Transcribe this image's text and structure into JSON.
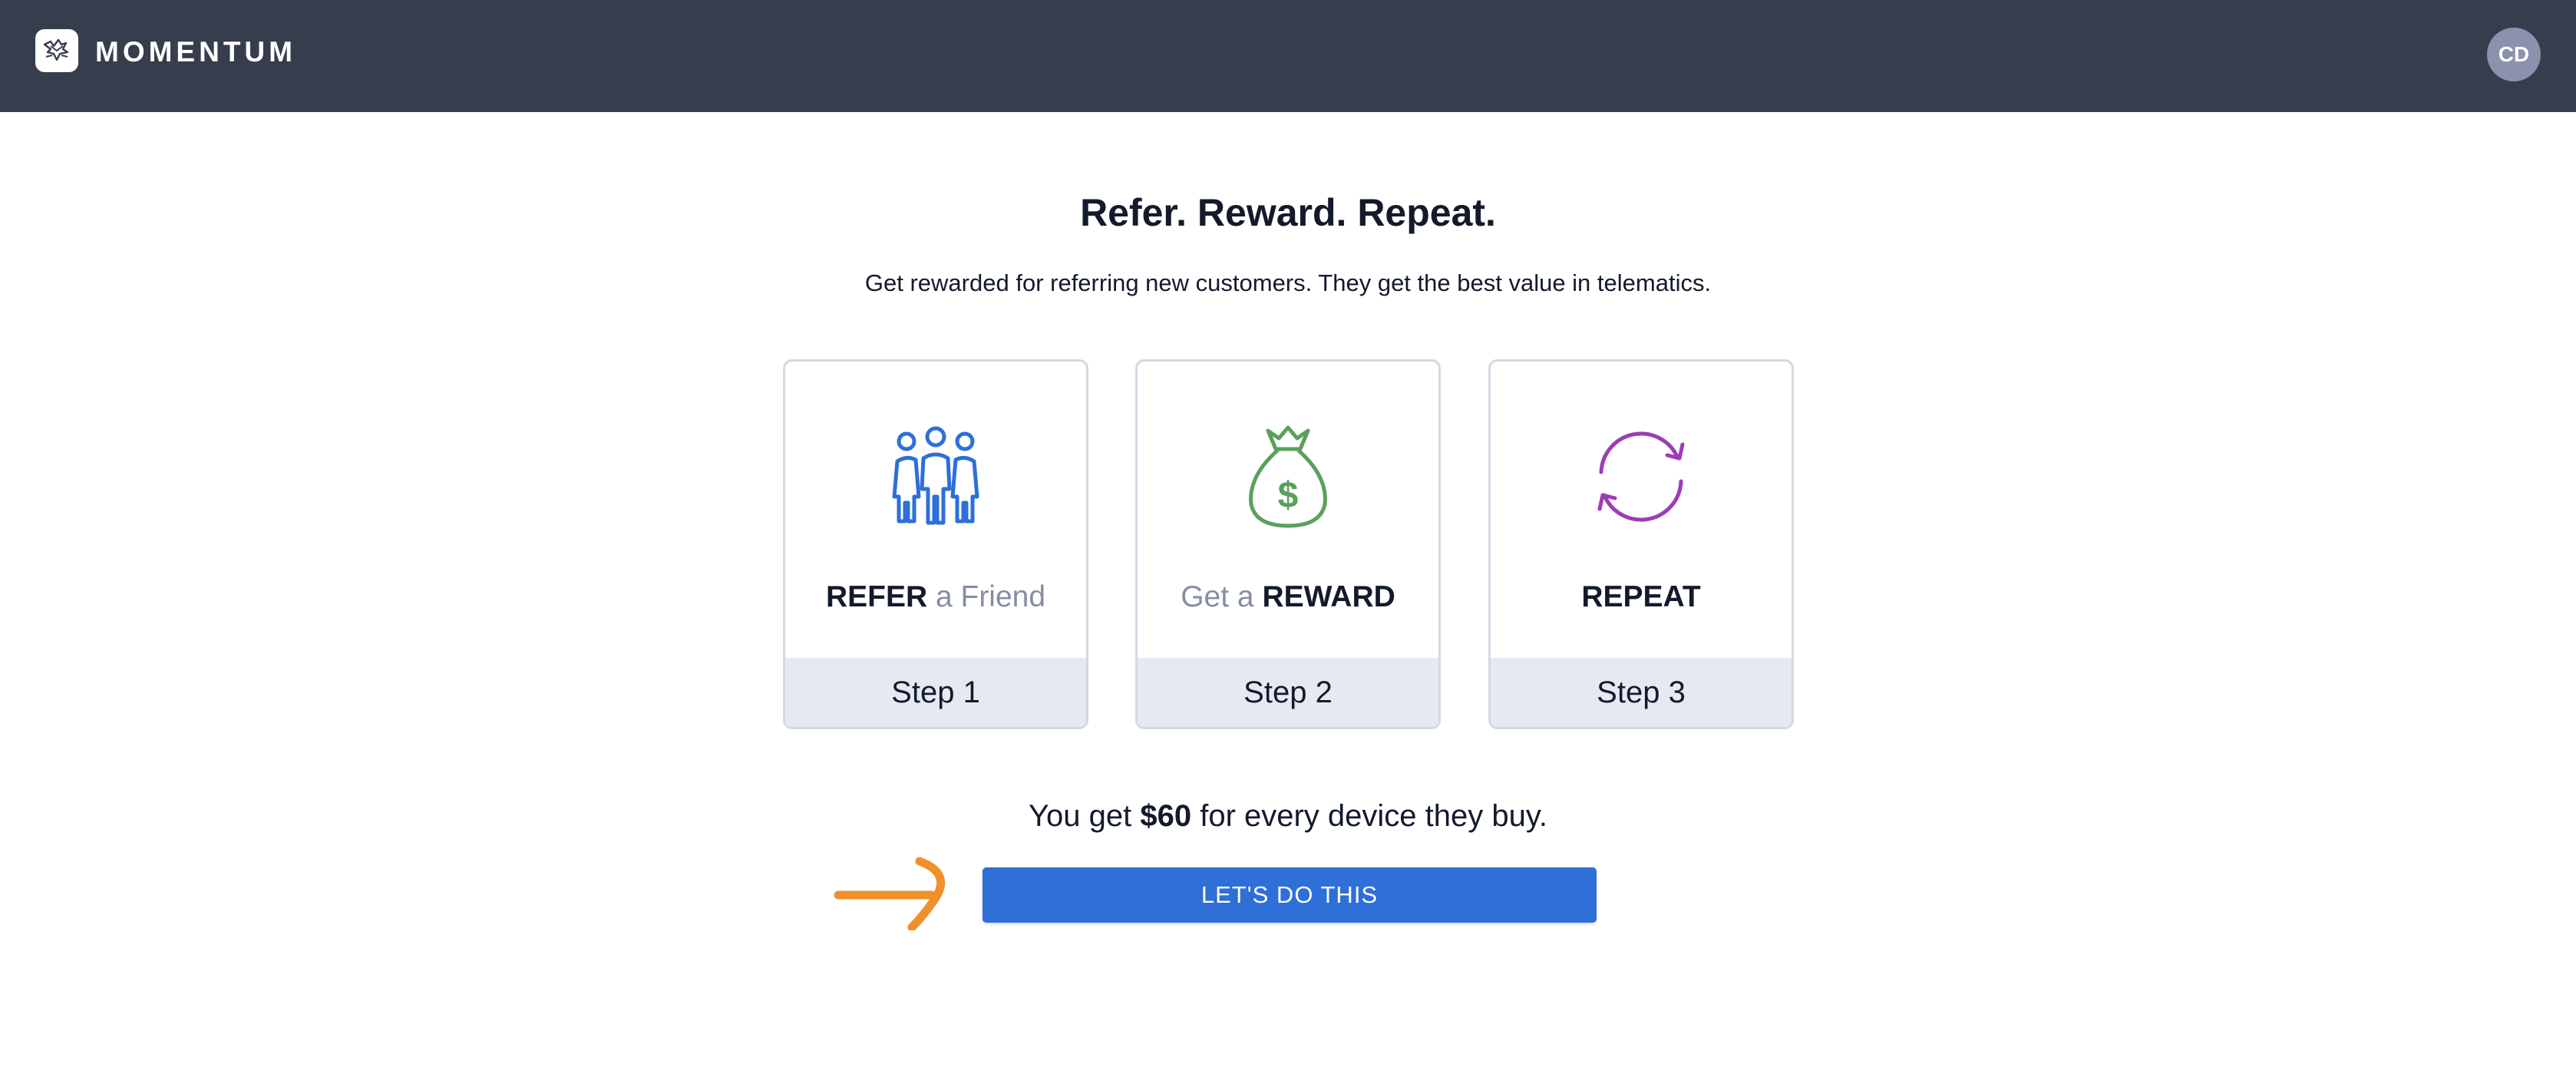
{
  "header": {
    "brand": "MOMENTUM",
    "avatar_initials": "CD",
    "logo_icon": "eagle-logo-icon"
  },
  "hero": {
    "title": "Refer. Reward. Repeat.",
    "subtitle": "Get rewarded for referring new customers. They get the best value in telematics."
  },
  "steps": [
    {
      "icon": "people-icon",
      "icon_color": "#2e6fd8",
      "title_strong": "REFER",
      "title_light": "a Friend",
      "step_label": "Step 1"
    },
    {
      "icon": "money-bag-icon",
      "icon_color": "#5aa05a",
      "title_light": "Get a",
      "title_strong": "REWARD",
      "step_label": "Step 2"
    },
    {
      "icon": "refresh-icon",
      "icon_color": "#9b3db5",
      "title_strong": "REPEAT",
      "step_label": "Step 3"
    }
  ],
  "offer": {
    "prefix": "You get",
    "amount": "$60",
    "suffix": "for every device they buy."
  },
  "cta": {
    "label": "LET'S DO THIS",
    "arrow_icon": "arrow-right-icon",
    "arrow_color": "#f0902a",
    "button_color": "#2e6fd8"
  },
  "colors": {
    "topbar": "#363d4c",
    "avatar": "#8a92ad",
    "card_footer": "#e5e9f2"
  }
}
